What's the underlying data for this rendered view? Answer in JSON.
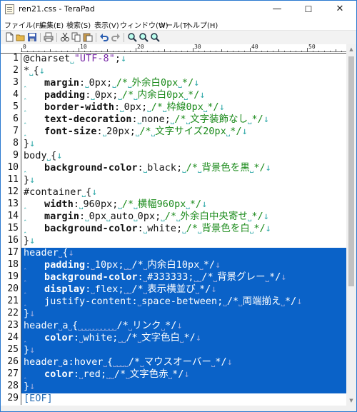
{
  "window": {
    "title": "ren21.css - TeraPad",
    "minimize_glyph": "—",
    "maximize_glyph": "☐",
    "close_glyph": "✕"
  },
  "menu": [
    "ファイル(F)",
    "編集(E)",
    "検索(S)",
    "表示(V)",
    "ウィンドウ(W)",
    "ツール(T)",
    "ヘルプ(H)"
  ],
  "toolbar_icons": [
    "new-file-icon",
    "open-folder-icon",
    "save-icon",
    "print-icon",
    "cut-icon",
    "copy-icon",
    "paste-icon",
    "undo-icon",
    "redo-icon",
    "search-icon",
    "search-next-icon",
    "search-prev-icon"
  ],
  "ruler": {
    "marks": [
      "0",
      "10",
      "20",
      "30",
      "40",
      "50"
    ]
  },
  "selection": {
    "from_line": 17,
    "to_line": 28,
    "color": "#0a62c8"
  },
  "lines": [
    {
      "n": "1",
      "segs": [
        {
          "t": "@charset",
          "c": "#111"
        },
        {
          "t": "˽",
          "c": "#3aa"
        },
        {
          "t": "\"UTF-8\"",
          "c": "#7a2aa8"
        },
        {
          "t": ";",
          "c": "#111"
        },
        {
          "t": "↓",
          "c": "#3aa"
        }
      ]
    },
    {
      "n": "2",
      "segs": [
        {
          "t": "*",
          "c": "#111"
        },
        {
          "t": "˽",
          "c": "#3aa"
        },
        {
          "t": "{",
          "c": "#111"
        },
        {
          "t": "↓",
          "c": "#3aa"
        }
      ]
    },
    {
      "n": "3",
      "segs": [
        {
          "t": "˰   ",
          "c": "#3aa"
        },
        {
          "t": "margin",
          "c": "#111",
          "b": true
        },
        {
          "t": ":",
          "c": "#111"
        },
        {
          "t": "˽",
          "c": "#3aa"
        },
        {
          "t": "0px",
          "c": "#111"
        },
        {
          "t": ";",
          "c": "#111"
        },
        {
          "t": "˽",
          "c": "#3aa"
        },
        {
          "t": "/*",
          "c": "#1a8a1a"
        },
        {
          "t": "˽",
          "c": "#3aa"
        },
        {
          "t": "外余白0px",
          "c": "#1a8a1a"
        },
        {
          "t": "˽",
          "c": "#3aa"
        },
        {
          "t": "*/",
          "c": "#1a8a1a"
        },
        {
          "t": "↓",
          "c": "#3aa"
        }
      ]
    },
    {
      "n": "4",
      "segs": [
        {
          "t": "˰   ",
          "c": "#3aa"
        },
        {
          "t": "padding",
          "c": "#111",
          "b": true
        },
        {
          "t": ":",
          "c": "#111"
        },
        {
          "t": "˽",
          "c": "#3aa"
        },
        {
          "t": "0px",
          "c": "#111"
        },
        {
          "t": ";",
          "c": "#111"
        },
        {
          "t": "˽",
          "c": "#3aa"
        },
        {
          "t": "/*",
          "c": "#1a8a1a"
        },
        {
          "t": "˽",
          "c": "#3aa"
        },
        {
          "t": "内余白0px",
          "c": "#1a8a1a"
        },
        {
          "t": "˽",
          "c": "#3aa"
        },
        {
          "t": "*/",
          "c": "#1a8a1a"
        },
        {
          "t": "↓",
          "c": "#3aa"
        }
      ]
    },
    {
      "n": "5",
      "segs": [
        {
          "t": "˰   ",
          "c": "#3aa"
        },
        {
          "t": "border-width",
          "c": "#111",
          "b": true
        },
        {
          "t": ":",
          "c": "#111"
        },
        {
          "t": "˽",
          "c": "#3aa"
        },
        {
          "t": "0px",
          "c": "#111"
        },
        {
          "t": ";",
          "c": "#111"
        },
        {
          "t": "˽",
          "c": "#3aa"
        },
        {
          "t": "/*",
          "c": "#1a8a1a"
        },
        {
          "t": "˽",
          "c": "#3aa"
        },
        {
          "t": "枠線0px",
          "c": "#1a8a1a"
        },
        {
          "t": "˽",
          "c": "#3aa"
        },
        {
          "t": "*/",
          "c": "#1a8a1a"
        },
        {
          "t": "↓",
          "c": "#3aa"
        }
      ]
    },
    {
      "n": "6",
      "segs": [
        {
          "t": "˰   ",
          "c": "#3aa"
        },
        {
          "t": "text-decoration",
          "c": "#111",
          "b": true
        },
        {
          "t": ":",
          "c": "#111"
        },
        {
          "t": "˽",
          "c": "#3aa"
        },
        {
          "t": "none",
          "c": "#111"
        },
        {
          "t": ";",
          "c": "#111"
        },
        {
          "t": "˽",
          "c": "#3aa"
        },
        {
          "t": "/*",
          "c": "#1a8a1a"
        },
        {
          "t": "˽",
          "c": "#3aa"
        },
        {
          "t": "文字装飾なし",
          "c": "#1a8a1a"
        },
        {
          "t": "˽",
          "c": "#3aa"
        },
        {
          "t": "*/",
          "c": "#1a8a1a"
        },
        {
          "t": "↓",
          "c": "#3aa"
        }
      ]
    },
    {
      "n": "7",
      "segs": [
        {
          "t": "˰   ",
          "c": "#3aa"
        },
        {
          "t": "font-size",
          "c": "#111",
          "b": true
        },
        {
          "t": ":",
          "c": "#111"
        },
        {
          "t": "˽",
          "c": "#3aa"
        },
        {
          "t": "20px",
          "c": "#111"
        },
        {
          "t": ";",
          "c": "#111"
        },
        {
          "t": "˽",
          "c": "#3aa"
        },
        {
          "t": "/*",
          "c": "#1a8a1a"
        },
        {
          "t": "˽",
          "c": "#3aa"
        },
        {
          "t": "文字サイズ20px",
          "c": "#1a8a1a"
        },
        {
          "t": "˽",
          "c": "#3aa"
        },
        {
          "t": "*/",
          "c": "#1a8a1a"
        },
        {
          "t": "↓",
          "c": "#3aa"
        }
      ]
    },
    {
      "n": "8",
      "segs": [
        {
          "t": "}",
          "c": "#111"
        },
        {
          "t": "↓",
          "c": "#3aa"
        }
      ]
    },
    {
      "n": "9",
      "segs": [
        {
          "t": "body",
          "c": "#111"
        },
        {
          "t": "˽",
          "c": "#3aa"
        },
        {
          "t": "{",
          "c": "#111"
        },
        {
          "t": "↓",
          "c": "#3aa"
        }
      ]
    },
    {
      "n": "10",
      "segs": [
        {
          "t": "˰   ",
          "c": "#3aa"
        },
        {
          "t": "background-color",
          "c": "#111",
          "b": true
        },
        {
          "t": ":",
          "c": "#111"
        },
        {
          "t": "˽",
          "c": "#3aa"
        },
        {
          "t": "black",
          "c": "#111"
        },
        {
          "t": ";",
          "c": "#111"
        },
        {
          "t": "˽",
          "c": "#3aa"
        },
        {
          "t": "/*",
          "c": "#1a8a1a"
        },
        {
          "t": "˽",
          "c": "#3aa"
        },
        {
          "t": "背景色を黒",
          "c": "#1a8a1a"
        },
        {
          "t": "˽",
          "c": "#3aa"
        },
        {
          "t": "*/",
          "c": "#1a8a1a"
        },
        {
          "t": "↓",
          "c": "#3aa"
        }
      ]
    },
    {
      "n": "11",
      "segs": [
        {
          "t": "}",
          "c": "#111"
        },
        {
          "t": "↓",
          "c": "#3aa"
        }
      ]
    },
    {
      "n": "12",
      "segs": [
        {
          "t": "#container",
          "c": "#111"
        },
        {
          "t": "˽",
          "c": "#3aa"
        },
        {
          "t": "{",
          "c": "#111"
        },
        {
          "t": "↓",
          "c": "#3aa"
        }
      ]
    },
    {
      "n": "13",
      "segs": [
        {
          "t": "˰   ",
          "c": "#3aa"
        },
        {
          "t": "width",
          "c": "#111",
          "b": true
        },
        {
          "t": ":",
          "c": "#111"
        },
        {
          "t": "˽",
          "c": "#3aa"
        },
        {
          "t": "960px",
          "c": "#111"
        },
        {
          "t": ";",
          "c": "#111"
        },
        {
          "t": "˽",
          "c": "#3aa"
        },
        {
          "t": "/*",
          "c": "#1a8a1a"
        },
        {
          "t": "˽",
          "c": "#3aa"
        },
        {
          "t": "横幅960px",
          "c": "#1a8a1a"
        },
        {
          "t": "˽",
          "c": "#3aa"
        },
        {
          "t": "*/",
          "c": "#1a8a1a"
        },
        {
          "t": "↓",
          "c": "#3aa"
        }
      ]
    },
    {
      "n": "14",
      "segs": [
        {
          "t": "˰   ",
          "c": "#3aa"
        },
        {
          "t": "margin",
          "c": "#111",
          "b": true
        },
        {
          "t": ":",
          "c": "#111"
        },
        {
          "t": "˽",
          "c": "#3aa"
        },
        {
          "t": "0px",
          "c": "#111"
        },
        {
          "t": "˽",
          "c": "#3aa"
        },
        {
          "t": "auto",
          "c": "#111"
        },
        {
          "t": "˽",
          "c": "#3aa"
        },
        {
          "t": "0px",
          "c": "#111"
        },
        {
          "t": ";",
          "c": "#111"
        },
        {
          "t": "˽",
          "c": "#3aa"
        },
        {
          "t": "/*",
          "c": "#1a8a1a"
        },
        {
          "t": "˽",
          "c": "#3aa"
        },
        {
          "t": "外余白中央寄せ",
          "c": "#1a8a1a"
        },
        {
          "t": "˽",
          "c": "#3aa"
        },
        {
          "t": "*/",
          "c": "#1a8a1a"
        },
        {
          "t": "↓",
          "c": "#3aa"
        }
      ]
    },
    {
      "n": "15",
      "segs": [
        {
          "t": "˰   ",
          "c": "#3aa"
        },
        {
          "t": "background-color",
          "c": "#111",
          "b": true
        },
        {
          "t": ":",
          "c": "#111"
        },
        {
          "t": "˽",
          "c": "#3aa"
        },
        {
          "t": "white",
          "c": "#111"
        },
        {
          "t": ";",
          "c": "#111"
        },
        {
          "t": "˽",
          "c": "#3aa"
        },
        {
          "t": "/*",
          "c": "#1a8a1a"
        },
        {
          "t": "˽",
          "c": "#3aa"
        },
        {
          "t": "背景色を白",
          "c": "#1a8a1a"
        },
        {
          "t": "˽",
          "c": "#3aa"
        },
        {
          "t": "*/",
          "c": "#1a8a1a"
        },
        {
          "t": "↓",
          "c": "#3aa"
        }
      ]
    },
    {
      "n": "16",
      "segs": [
        {
          "t": "}",
          "c": "#111"
        },
        {
          "t": "↓",
          "c": "#3aa"
        }
      ]
    },
    {
      "n": "17",
      "sel": true,
      "segs": [
        {
          "t": "header",
          "c": "#fff"
        },
        {
          "t": "˽",
          "c": "#9ad"
        },
        {
          "t": "{",
          "c": "#fff"
        },
        {
          "t": "↓",
          "c": "#9ad"
        }
      ]
    },
    {
      "n": "18",
      "sel": true,
      "segs": [
        {
          "t": "˰   ",
          "c": "#9ad"
        },
        {
          "t": "padding",
          "c": "#fff",
          "b": true
        },
        {
          "t": ":",
          "c": "#fff"
        },
        {
          "t": "˽",
          "c": "#9ad"
        },
        {
          "t": "10px",
          "c": "#fff"
        },
        {
          "t": ";",
          "c": "#fff"
        },
        {
          "t": "˽˽",
          "c": "#9ad"
        },
        {
          "t": "/*",
          "c": "#fff"
        },
        {
          "t": "˽",
          "c": "#9ad"
        },
        {
          "t": "内余白10px",
          "c": "#fff"
        },
        {
          "t": "˽",
          "c": "#9ad"
        },
        {
          "t": "*/",
          "c": "#fff"
        },
        {
          "t": "↓",
          "c": "#9ad"
        }
      ]
    },
    {
      "n": "19",
      "sel": true,
      "segs": [
        {
          "t": "˰   ",
          "c": "#9ad"
        },
        {
          "t": "background-color",
          "c": "#fff",
          "b": true
        },
        {
          "t": ":",
          "c": "#fff"
        },
        {
          "t": "˽",
          "c": "#9ad"
        },
        {
          "t": "#333333",
          "c": "#fff"
        },
        {
          "t": ";",
          "c": "#fff"
        },
        {
          "t": "˽˽",
          "c": "#9ad"
        },
        {
          "t": "/*",
          "c": "#fff"
        },
        {
          "t": "˽",
          "c": "#9ad"
        },
        {
          "t": "背景グレー",
          "c": "#fff"
        },
        {
          "t": "˽",
          "c": "#9ad"
        },
        {
          "t": "*/",
          "c": "#fff"
        },
        {
          "t": "↓",
          "c": "#9ad"
        }
      ]
    },
    {
      "n": "20",
      "sel": true,
      "segs": [
        {
          "t": "˰   ",
          "c": "#9ad"
        },
        {
          "t": "display",
          "c": "#fff",
          "b": true
        },
        {
          "t": ":",
          "c": "#fff"
        },
        {
          "t": "˽",
          "c": "#9ad"
        },
        {
          "t": "flex",
          "c": "#fff"
        },
        {
          "t": ";",
          "c": "#fff"
        },
        {
          "t": "˽˽",
          "c": "#9ad"
        },
        {
          "t": "/*",
          "c": "#fff"
        },
        {
          "t": "˽",
          "c": "#9ad"
        },
        {
          "t": "表示横並び",
          "c": "#fff"
        },
        {
          "t": "˽",
          "c": "#9ad"
        },
        {
          "t": "*/",
          "c": "#fff"
        },
        {
          "t": "↓",
          "c": "#9ad"
        }
      ]
    },
    {
      "n": "21",
      "sel": true,
      "segs": [
        {
          "t": "˰   ",
          "c": "#9ad"
        },
        {
          "t": "justify-content",
          "c": "#fff"
        },
        {
          "t": ":",
          "c": "#fff"
        },
        {
          "t": "˽",
          "c": "#9ad"
        },
        {
          "t": "space-between",
          "c": "#fff"
        },
        {
          "t": ";",
          "c": "#fff"
        },
        {
          "t": "˽",
          "c": "#9ad"
        },
        {
          "t": "/*",
          "c": "#fff"
        },
        {
          "t": "˽",
          "c": "#9ad"
        },
        {
          "t": "両端揃え",
          "c": "#fff"
        },
        {
          "t": "˽",
          "c": "#9ad"
        },
        {
          "t": "*/",
          "c": "#fff"
        },
        {
          "t": "↓",
          "c": "#9ad"
        }
      ]
    },
    {
      "n": "22",
      "sel": true,
      "segs": [
        {
          "t": "}",
          "c": "#fff"
        },
        {
          "t": "↓",
          "c": "#9ad"
        }
      ]
    },
    {
      "n": "23",
      "sel": true,
      "segs": [
        {
          "t": "header",
          "c": "#fff"
        },
        {
          "t": "˽",
          "c": "#9ad"
        },
        {
          "t": "a",
          "c": "#fff"
        },
        {
          "t": "˽",
          "c": "#9ad"
        },
        {
          "t": "{",
          "c": "#fff"
        },
        {
          "t": "˽˽˽˽˽˽˽˽˽˽",
          "c": "#9ad"
        },
        {
          "t": "/*",
          "c": "#fff"
        },
        {
          "t": "˽",
          "c": "#9ad"
        },
        {
          "t": "リンク",
          "c": "#fff"
        },
        {
          "t": "˽",
          "c": "#9ad"
        },
        {
          "t": "*/",
          "c": "#fff"
        },
        {
          "t": "↓",
          "c": "#9ad"
        }
      ]
    },
    {
      "n": "24",
      "sel": true,
      "segs": [
        {
          "t": "˰   ",
          "c": "#9ad"
        },
        {
          "t": "color",
          "c": "#fff",
          "b": true
        },
        {
          "t": ":",
          "c": "#fff"
        },
        {
          "t": "˽",
          "c": "#9ad"
        },
        {
          "t": "white",
          "c": "#fff"
        },
        {
          "t": ";",
          "c": "#fff"
        },
        {
          "t": "˽˽",
          "c": "#9ad"
        },
        {
          "t": "/*",
          "c": "#fff"
        },
        {
          "t": "˽",
          "c": "#9ad"
        },
        {
          "t": "文字色白",
          "c": "#fff"
        },
        {
          "t": "˽",
          "c": "#9ad"
        },
        {
          "t": "*/",
          "c": "#fff"
        },
        {
          "t": "↓",
          "c": "#9ad"
        }
      ]
    },
    {
      "n": "25",
      "sel": true,
      "segs": [
        {
          "t": "}",
          "c": "#fff"
        },
        {
          "t": "↓",
          "c": "#9ad"
        }
      ]
    },
    {
      "n": "26",
      "sel": true,
      "segs": [
        {
          "t": "header",
          "c": "#fff"
        },
        {
          "t": "˽",
          "c": "#9ad"
        },
        {
          "t": "a:hover",
          "c": "#fff"
        },
        {
          "t": "˽",
          "c": "#9ad"
        },
        {
          "t": "{",
          "c": "#fff"
        },
        {
          "t": "˽˽˽˽",
          "c": "#9ad"
        },
        {
          "t": "/*",
          "c": "#fff"
        },
        {
          "t": "˽",
          "c": "#9ad"
        },
        {
          "t": "マウスオーバー",
          "c": "#fff"
        },
        {
          "t": "˽",
          "c": "#9ad"
        },
        {
          "t": "*/",
          "c": "#fff"
        },
        {
          "t": "↓",
          "c": "#9ad"
        }
      ]
    },
    {
      "n": "27",
      "sel": true,
      "segs": [
        {
          "t": "˰   ",
          "c": "#9ad"
        },
        {
          "t": "color",
          "c": "#fff",
          "b": true
        },
        {
          "t": ":",
          "c": "#fff"
        },
        {
          "t": "˽",
          "c": "#9ad"
        },
        {
          "t": "red",
          "c": "#fff"
        },
        {
          "t": ";",
          "c": "#fff"
        },
        {
          "t": "˽˽",
          "c": "#9ad"
        },
        {
          "t": "/*",
          "c": "#fff"
        },
        {
          "t": "˽",
          "c": "#9ad"
        },
        {
          "t": "文字色赤",
          "c": "#fff"
        },
        {
          "t": "˽",
          "c": "#9ad"
        },
        {
          "t": "*/",
          "c": "#fff"
        },
        {
          "t": "↓",
          "c": "#9ad"
        }
      ]
    },
    {
      "n": "28",
      "sel": true,
      "segs": [
        {
          "t": "}",
          "c": "#fff"
        },
        {
          "t": "↓",
          "c": "#9ad"
        }
      ]
    },
    {
      "n": "29",
      "segs": [
        {
          "t": "[EOF]",
          "c": "#2b6fb4"
        }
      ]
    }
  ]
}
